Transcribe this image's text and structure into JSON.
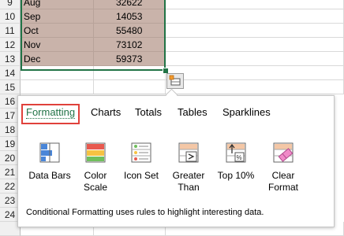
{
  "sheet": {
    "rows": [
      {
        "num": "9",
        "month": "Aug",
        "value": "32622"
      },
      {
        "num": "10",
        "month": "Sep",
        "value": "14053"
      },
      {
        "num": "11",
        "month": "Oct",
        "value": "55480"
      },
      {
        "num": "12",
        "month": "Nov",
        "value": "73102"
      },
      {
        "num": "13",
        "month": "Dec",
        "value": "59373"
      },
      {
        "num": "14"
      },
      {
        "num": "15"
      },
      {
        "num": "16"
      },
      {
        "num": "17"
      },
      {
        "num": "18"
      },
      {
        "num": "19"
      },
      {
        "num": "20"
      },
      {
        "num": "21"
      },
      {
        "num": "22"
      },
      {
        "num": "23"
      },
      {
        "num": "24"
      }
    ]
  },
  "quick_analysis": {
    "button_icon": "quick-analysis-icon",
    "tabs": [
      {
        "label": "Formatting",
        "active": true
      },
      {
        "label": "Charts"
      },
      {
        "label": "Totals"
      },
      {
        "label": "Tables"
      },
      {
        "label": "Sparklines"
      }
    ],
    "tools": [
      {
        "label": "Data Bars",
        "icon": "data-bars-icon"
      },
      {
        "label": "Color Scale",
        "icon": "color-scale-icon"
      },
      {
        "label": "Icon Set",
        "icon": "icon-set-icon"
      },
      {
        "label": "Greater Than",
        "icon": "greater-than-icon"
      },
      {
        "label": "Top 10%",
        "icon": "top-10-icon"
      },
      {
        "label": "Clear Format",
        "icon": "clear-format-icon"
      }
    ],
    "description": "Conditional Formatting uses rules to highlight interesting data."
  }
}
